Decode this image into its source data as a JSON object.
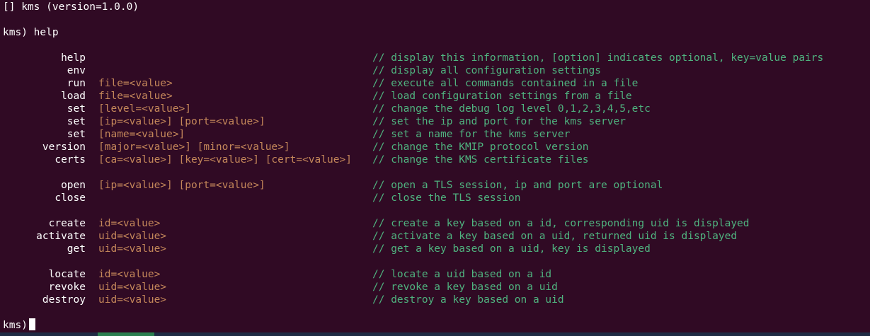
{
  "terminal": {
    "title_line": "[] kms (version=1.0.0)",
    "prompt_cmd": "kms) help",
    "final_prompt": "kms)"
  },
  "help": [
    {
      "cmd": "help",
      "args": "",
      "comment": "// display this information, [option] indicates optional, key=value pairs"
    },
    {
      "cmd": "env",
      "args": "",
      "comment": "// display all configuration settings"
    },
    {
      "cmd": "run",
      "args": "file=<value>",
      "comment": "// execute all commands contained in a file"
    },
    {
      "cmd": "load",
      "args": "file=<value>",
      "comment": "// load configuration settings from a file"
    },
    {
      "cmd": "set",
      "args": "[level=<value>]",
      "comment": "// change the debug log level 0,1,2,3,4,5,etc"
    },
    {
      "cmd": "set",
      "args": "[ip=<value>] [port=<value>]",
      "comment": "// set the ip and port for the kms server"
    },
    {
      "cmd": "set",
      "args": "[name=<value>]",
      "comment": "// set a name for the kms server"
    },
    {
      "cmd": "version",
      "args": "[major=<value>] [minor=<value>]",
      "comment": "// change the KMIP protocol version"
    },
    {
      "cmd": "certs",
      "args": "[ca=<value>] [key=<value>] [cert=<value>]",
      "comment": "// change the KMS certificate files"
    },
    {
      "cmd": "open",
      "args": "[ip=<value>] [port=<value>]",
      "comment": "// open a TLS session, ip and port are optional"
    },
    {
      "cmd": "close",
      "args": "",
      "comment": "// close the TLS session"
    },
    {
      "cmd": "create",
      "args": "id=<value>",
      "comment": "// create a key based on a id, corresponding uid is displayed"
    },
    {
      "cmd": "activate",
      "args": "uid=<value>",
      "comment": "// activate a key based on a uid, returned uid is displayed"
    },
    {
      "cmd": "get",
      "args": "uid=<value>",
      "comment": "// get a key based on a uid, key is displayed"
    },
    {
      "cmd": "locate",
      "args": "id=<value>",
      "comment": "// locate a uid based on a id"
    },
    {
      "cmd": "revoke",
      "args": "uid=<value>",
      "comment": "// revoke a key based on a uid"
    },
    {
      "cmd": "destroy",
      "args": "uid=<value>",
      "comment": "// destroy a key based on a uid"
    }
  ]
}
